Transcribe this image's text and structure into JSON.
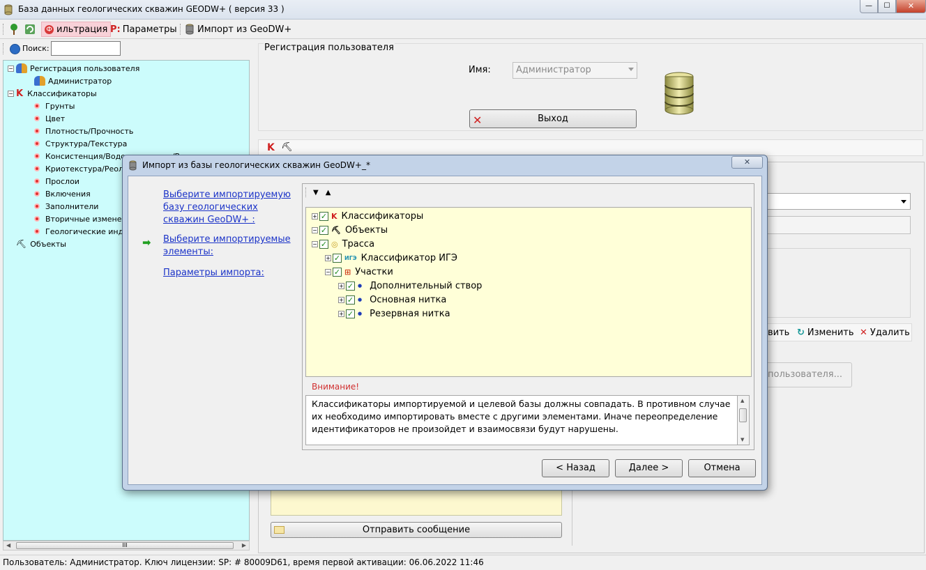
{
  "window": {
    "title": "База данных геологических скважин GEODW+ ( версия 33 )",
    "min_label": "—",
    "max_label": "☐",
    "close_label": "✕"
  },
  "toolbar": {
    "filter_label": "ильтрация",
    "params_label": "Параметры",
    "import_label": "Импорт из GeoDW+"
  },
  "search": {
    "label": "Поиск:",
    "value": ""
  },
  "tree": {
    "items": [
      {
        "label": "Регистрация пользователя",
        "level": 0,
        "icon": "users-icon"
      },
      {
        "label": "Администратор",
        "level": 1,
        "icon": "admin-icon"
      },
      {
        "label": "Классификаторы",
        "level": 0,
        "icon": "k-icon"
      },
      {
        "label": "Грунты",
        "level": 1
      },
      {
        "label": "Цвет",
        "level": 1
      },
      {
        "label": "Плотность/Прочность",
        "level": 1
      },
      {
        "label": "Структура/Текстура",
        "level": 1
      },
      {
        "label": "Консистенция/Водонасыщение/Водопроницаемость",
        "level": 1
      },
      {
        "label": "Криотекстура/Реология",
        "level": 1
      },
      {
        "label": "Прослои",
        "level": 1
      },
      {
        "label": "Включения",
        "level": 1
      },
      {
        "label": "Заполнители",
        "level": 1
      },
      {
        "label": "Вторичные изменения",
        "level": 1
      },
      {
        "label": "Геологические индексы",
        "level": 1
      },
      {
        "label": "Объекты",
        "level": 0,
        "icon": "drill-icon"
      }
    ],
    "scroll_grip": "III"
  },
  "registration": {
    "title": "Регистрация пользователя",
    "name_label": "Имя:",
    "name_value": "Администратор",
    "exit_label": "Выход"
  },
  "right_panel": {
    "add_label": "вить",
    "edit_label": "Изменить",
    "delete_label": "Удалить",
    "user_button_label": "пользователя..."
  },
  "send_button_label": "Отправить сообщение",
  "status_text": "Пользователь: Администратор.  Ключ лицензии: SP: # 80009D61, время первой активации: 06.06.2022 11:46",
  "dialog": {
    "title": "Импорт из базы геологических скважин GeoDW+_*",
    "close_label": "✕",
    "steps": [
      "Выберите импортируемую базу геологических скважин GeoDW+  :",
      "Выберите импортируемые элементы:",
      "Параметры импорта:"
    ],
    "tree_toolbar": {
      "collapse": "▼",
      "expand": "▲"
    },
    "objects_tree": [
      {
        "label": "Классификаторы",
        "level": 0,
        "expander": "+",
        "icon": "K"
      },
      {
        "label": "Объекты",
        "level": 0,
        "expander": "−",
        "icon": "⛏"
      },
      {
        "label": "Трасса",
        "level": 1,
        "expander": "−",
        "icon": "◎"
      },
      {
        "label": "Классификатор ИГЭ",
        "level": 2,
        "expander": "+",
        "icon": "ИГЭ"
      },
      {
        "label": "Участки",
        "level": 2,
        "expander": "−",
        "icon": "⊞"
      },
      {
        "label": "Дополнительный створ",
        "level": 3,
        "expander": "+",
        "icon": "●"
      },
      {
        "label": "Основная нитка",
        "level": 3,
        "expander": "+",
        "icon": "●"
      },
      {
        "label": "Резервная нитка",
        "level": 3,
        "expander": "+",
        "icon": "●"
      }
    ],
    "warning_title": "Внимание!",
    "warning_text": "Классификаторы импортируемой и целевой базы должны совпадать. В противном случае их необходимо импортировать вместе с другими элементами. Иначе переопределение идентификаторов не произойдет и взаимосвязи будут нарушены.",
    "back_label": "< Назад",
    "next_label": "Далее >",
    "cancel_label": "Отмена"
  }
}
